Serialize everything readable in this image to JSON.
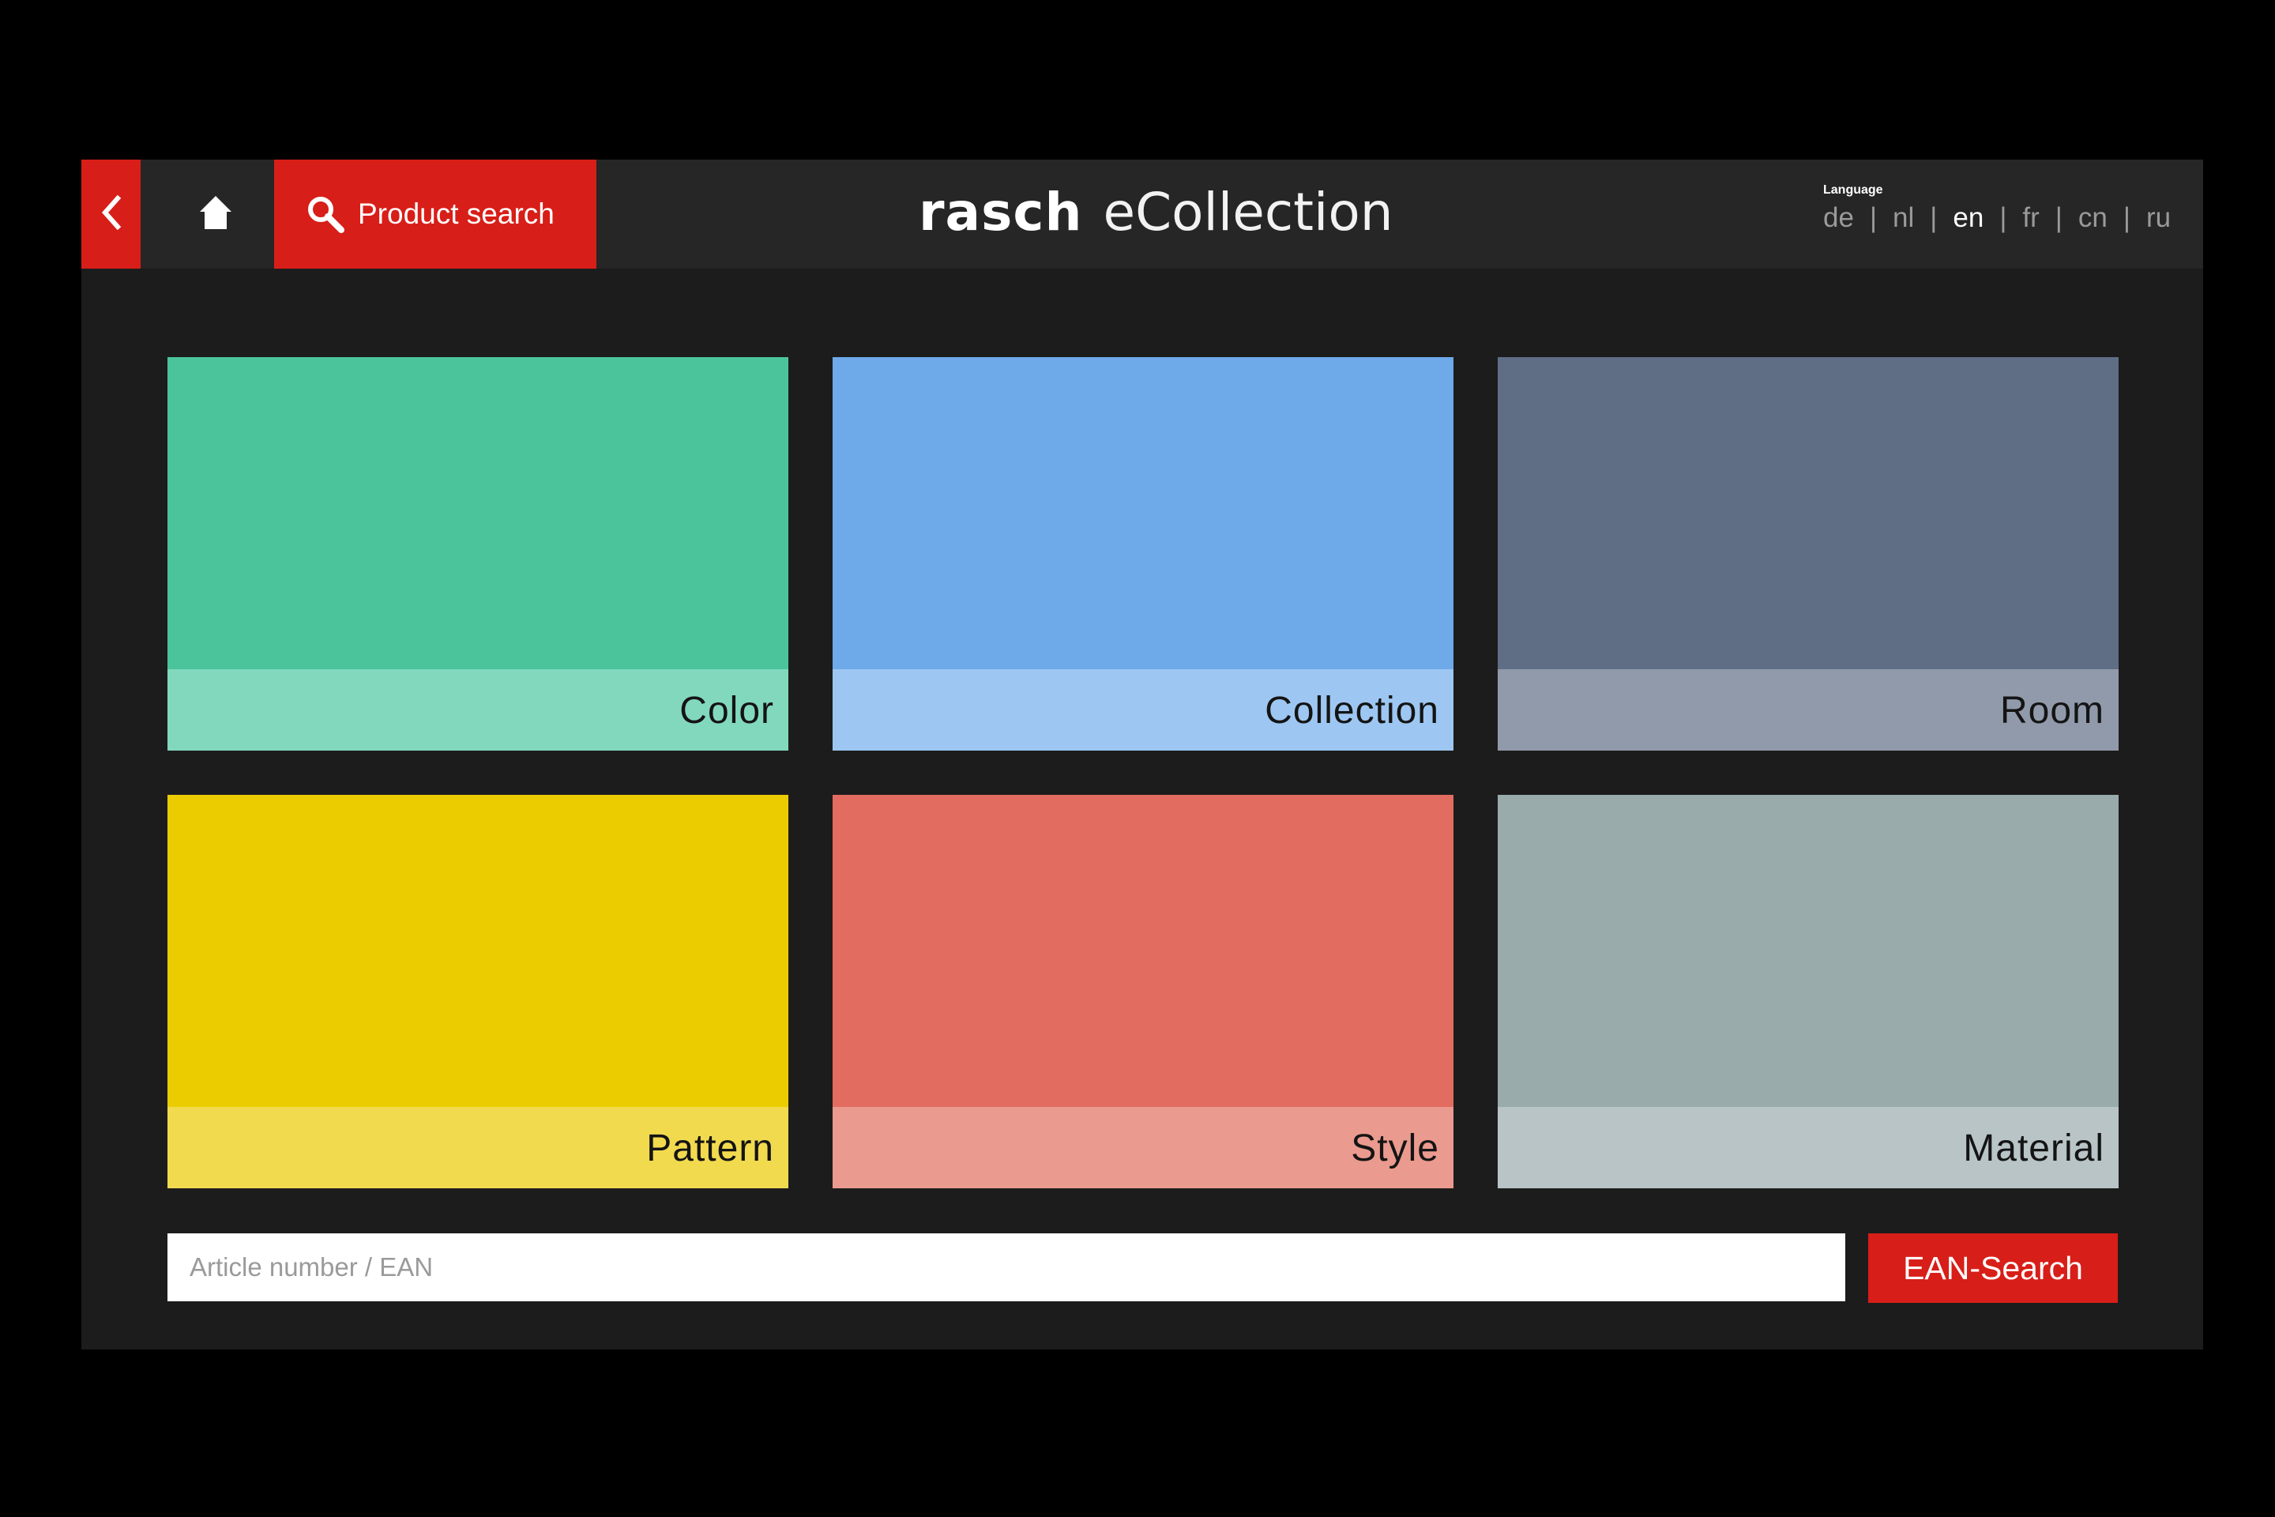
{
  "header": {
    "back_icon": "chevron-left-icon",
    "home_icon": "home-icon",
    "search_icon": "search-icon",
    "product_search_label": "Product search",
    "brand_strong": "rasch",
    "brand_light": "eCollection"
  },
  "language": {
    "title": "Language",
    "options": [
      {
        "code": "de",
        "active": false
      },
      {
        "code": "nl",
        "active": false
      },
      {
        "code": "en",
        "active": true
      },
      {
        "code": "fr",
        "active": false
      },
      {
        "code": "cn",
        "active": false
      },
      {
        "code": "ru",
        "active": false
      }
    ],
    "separator": "|"
  },
  "tiles": [
    {
      "label": "Color",
      "color_top": "#4bc49c",
      "color_bottom": "#82d8bd"
    },
    {
      "label": "Collection",
      "color_top": "#6ea9ea",
      "color_bottom": "#9dc6f2"
    },
    {
      "label": "Room",
      "color_top": "#5f6e85",
      "color_bottom": "#909aaa"
    },
    {
      "label": "Pattern",
      "color_top": "#ebcc00",
      "color_bottom": "#f2da4f"
    },
    {
      "label": "Style",
      "color_top": "#e26c60",
      "color_bottom": "#ea9a8e"
    },
    {
      "label": "Material",
      "color_top": "#99abab",
      "color_bottom": "#b8c4c6"
    }
  ],
  "ean": {
    "placeholder": "Article number / EAN",
    "value": "",
    "button_label": "EAN-Search"
  },
  "colors": {
    "accent_red": "#d81e18",
    "header_bg": "#262626",
    "panel_bg": "#1c1c1c"
  }
}
